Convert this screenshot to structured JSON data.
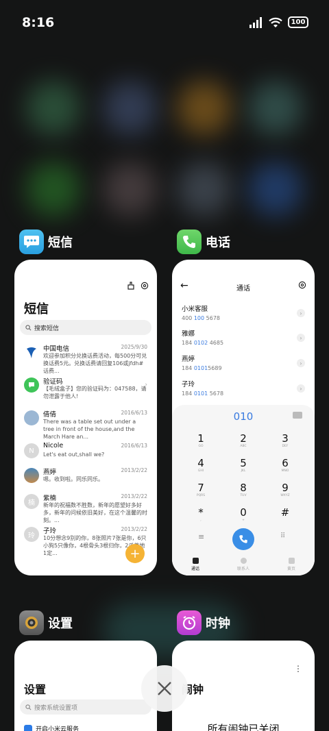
{
  "status_bar": {
    "time": "8:16",
    "battery": "100",
    "icons": [
      "signal-icon",
      "wifi-icon",
      "battery-icon"
    ]
  },
  "apps": {
    "messages": {
      "name": "短信",
      "title": "短信",
      "search_placeholder": "搜索短信",
      "fab_label": "+",
      "items": [
        {
          "name": "中国电信",
          "date": "2025/9/30",
          "preview": "欢迎参加积分兑换话费活动，每500分可兑换话费5元。兑换话费请回复106或jfdh#话费...",
          "avatar_color": "#1a5fb4"
        },
        {
          "name": "验证码",
          "date": "",
          "preview": "【毛绒盒子】您的验证码为：047588，请勿泄露于他人!",
          "avatar_color": "#3fc459"
        },
        {
          "name": "倩倩",
          "date": "2016/6/13",
          "preview": "There was a table set out under a tree in front of the house,and the March Hare an...",
          "avatar_color": "#9bb7d4"
        },
        {
          "name": "Nicole",
          "date": "2016/6/13",
          "preview": "Let's eat out,shall we?",
          "avatar_color": "#d8d8d8",
          "initial": "N"
        },
        {
          "name": "燕婷",
          "date": "2013/2/22",
          "preview": "嗯。收到啦。同乐同乐。",
          "avatar_color": "#c08a4e"
        },
        {
          "name": "紫楠",
          "date": "2013/2/22",
          "preview": "新年的祝福数不胜数，新年的愿望好多好多，新年的问候依旧美好，在这个温馨的时刻。...",
          "avatar_color": "#d8d8d8",
          "initial": "楠"
        },
        {
          "name": "子玲",
          "date": "2013/2/22",
          "preview": "10分想念9别的你，8张照片7张是你，6只小狗5只像你，4根骨头3根归你，2爪着地1定...",
          "avatar_color": "#d8d8d8",
          "initial": "玲"
        }
      ]
    },
    "phone": {
      "name": "电话",
      "title": "通话",
      "contacts": [
        {
          "name": "小米客服",
          "num_pre": "400 ",
          "num_hl": "100",
          "num_post": " 5678"
        },
        {
          "name": "雅娜",
          "num_pre": "184 ",
          "num_hl": "0102",
          "num_post": " 4685"
        },
        {
          "name": "燕婷",
          "num_pre": "184 ",
          "num_hl": "0101",
          "num_post": "5689"
        },
        {
          "name": "子玲",
          "num_pre": "184 ",
          "num_hl": "0101",
          "num_post": " 5678"
        }
      ],
      "dial_value": "010",
      "keys": [
        {
          "d": "1",
          "l": "GO"
        },
        {
          "d": "2",
          "l": "ABC"
        },
        {
          "d": "3",
          "l": "DEF"
        },
        {
          "d": "4",
          "l": "GHI"
        },
        {
          "d": "5",
          "l": "JKL"
        },
        {
          "d": "6",
          "l": "MNO"
        },
        {
          "d": "7",
          "l": "PQRS"
        },
        {
          "d": "8",
          "l": "TUV"
        },
        {
          "d": "9",
          "l": "WXYZ"
        },
        {
          "d": "*",
          "l": ","
        },
        {
          "d": "0",
          "l": "+"
        },
        {
          "d": "#",
          "l": ""
        }
      ],
      "nav": [
        "通话",
        "联系人",
        "黄页"
      ]
    },
    "settings": {
      "name": "设置",
      "title": "设置",
      "search_placeholder": "搜索系统设置项",
      "row_label": "开启小米云服务"
    },
    "clock": {
      "name": "时钟",
      "title": "闹钟",
      "message": "所有闹钟已关闭"
    }
  },
  "close_button_label": "×"
}
